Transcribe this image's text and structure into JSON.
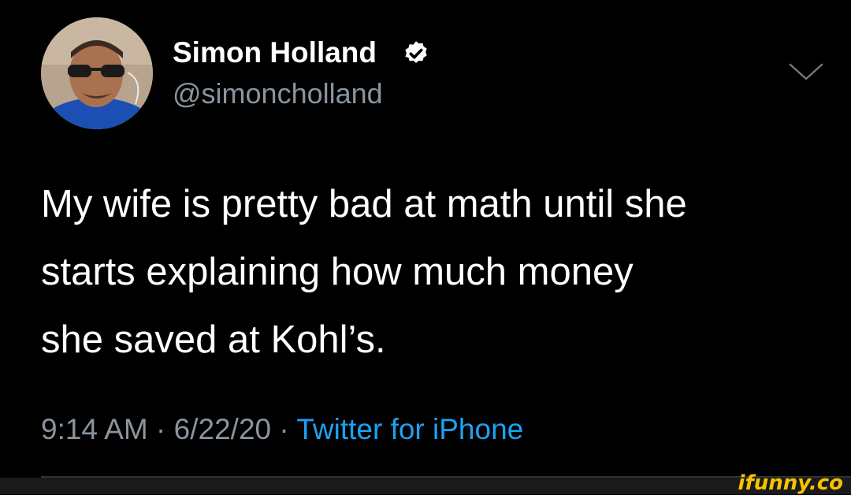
{
  "tweet": {
    "display_name": "Simon Holland",
    "handle": "@simoncholland",
    "text_lines": [
      "My wife is pretty bad at math until she",
      "starts explaining how much money",
      "she saved at Kohl’s."
    ],
    "time": "9:14 AM",
    "separator": " · ",
    "date": "6/22/20",
    "source": "Twitter for iPhone"
  },
  "watermark": "ifunny.co",
  "icons": {
    "verified": "verified-badge-icon",
    "menu": "chevron-down-icon",
    "avatar": "avatar"
  },
  "colors": {
    "background": "#000000",
    "text": "#ffffff",
    "muted": "#8a949d",
    "link": "#1da1f2",
    "watermark": "#f6c300"
  }
}
